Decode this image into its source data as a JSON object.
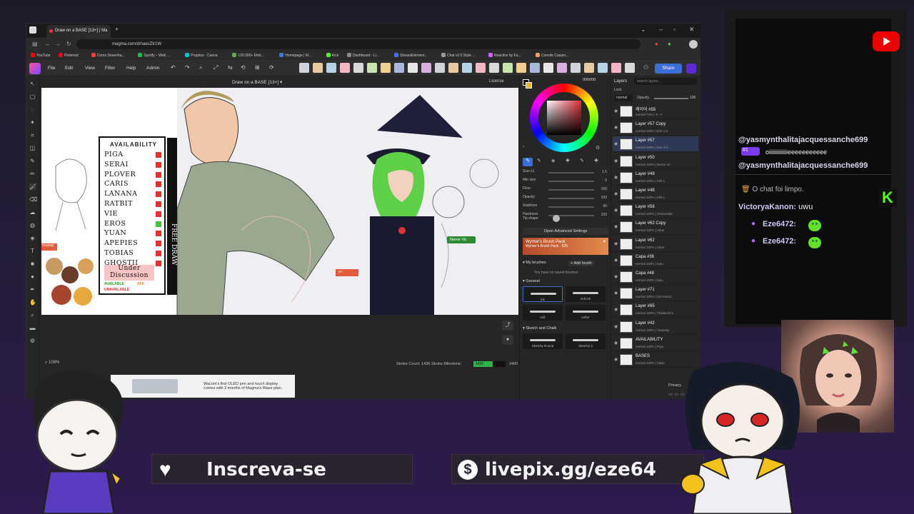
{
  "browser": {
    "tab_title": "Draw on a BASE [13+] | Ma",
    "url": "magma.com/d/naecZtr1W",
    "bookmarks": [
      {
        "label": "YouTube",
        "color": "#ff0000"
      },
      {
        "label": "Pinterest",
        "color": "#e60023"
      },
      {
        "label": "Como Desenha...",
        "color": "#ff3b3b"
      },
      {
        "label": "Spotify – Web ...",
        "color": "#1db954"
      },
      {
        "label": "Projetos - Canva",
        "color": "#00c4cc"
      },
      {
        "label": "100.000+ Efeit...",
        "color": "#6aa84f"
      },
      {
        "label": "Homepage | M...",
        "color": "#3c78d8"
      },
      {
        "label": "Kick",
        "color": "#53fc18"
      },
      {
        "label": "Dashboard - Li...",
        "color": "#888888"
      },
      {
        "label": "StreamElement...",
        "color": "#4b6cff"
      },
      {
        "label": "Chat v2.0 Style ...",
        "color": "#999999"
      },
      {
        "label": "Reactive by Fu...",
        "color": "#cc66ff"
      },
      {
        "label": "Convite Casam...",
        "color": "#ff9966"
      }
    ]
  },
  "app": {
    "menu": [
      "File",
      "Edit",
      "View",
      "Filter",
      "Help",
      "Admin"
    ],
    "share_label": "Share",
    "canvas_title": "Draw on a BASE [13+]",
    "license_label": "License",
    "zoom": "108%",
    "stroke_count_label": "Stroke Count: 1436",
    "stroke_milestone_label": "Stroke Milestone:",
    "stroke_value": "1436",
    "stroke_target": "2400",
    "stroke_progress": 0.6,
    "ad_text": "Wacom's first OLED pen and touch display comes with 3 months of Magma's Blaze plan.",
    "neme_tag": "Neme Vic",
    "user_tag": "ᵀᴴ'ᵀ"
  },
  "availability": {
    "title": "AVAILABILITY",
    "names": [
      {
        "name": "PIGA",
        "status": "#e03232"
      },
      {
        "name": "SERAI",
        "status": "#e03232"
      },
      {
        "name": "PLOVER",
        "status": "#e03232"
      },
      {
        "name": "CARIS",
        "status": "#e03232"
      },
      {
        "name": "LANANA",
        "status": "#e03232"
      },
      {
        "name": "RATBIT",
        "status": "#e03232"
      },
      {
        "name": "VIE",
        "status": "#e03232"
      },
      {
        "name": "EROS",
        "status": "#3cc43c"
      },
      {
        "name": "YUAN",
        "status": "#e03232"
      },
      {
        "name": "APEPIES",
        "status": "#e03232"
      },
      {
        "name": "TOBIAS",
        "status": "#e03232"
      },
      {
        "name": "GHOSTII",
        "status": "#e03232"
      }
    ],
    "under_discussion": "Under Discussion",
    "legend_available": "AVAILABLE",
    "legend_afk": "AFK",
    "legend_unavailable": "UNAVAILABLE",
    "free_draw": "FREE DRAW",
    "munay": "munay"
  },
  "brush": {
    "hex": "000000",
    "sliders": [
      {
        "label": "Size x1",
        "value": "1.5"
      },
      {
        "label": "Min size",
        "value": "0"
      },
      {
        "label": "Flow",
        "value": "100"
      },
      {
        "label": "Opacity",
        "value": "100"
      },
      {
        "label": "Stabilizer",
        "value": "66"
      },
      {
        "label": "Hardness",
        "value": "100"
      }
    ],
    "tip_shape": "Tip shape",
    "open_advanced": "Open Advanced Settings",
    "pack_title": "Wynter's Brush Pack",
    "pack_sub": "Wynter's Brush Pack · 525",
    "my_brushes": "My brushes",
    "add_brush": "Add brush",
    "no_brushes": "You have no saved brushes",
    "general": "General",
    "brushes_general": [
      "ink",
      "soft ink",
      "soft",
      "softer"
    ],
    "sketch": "Sketch and Chalk",
    "brushes_sketch": [
      "Sketchy Round",
      "Sketchy 2"
    ]
  },
  "layers": {
    "header": "Layers",
    "search_placeholder": "search layers...",
    "lock": "Lock",
    "blend": "normal",
    "opacity_label": "Opacity",
    "opacity": "100",
    "items": [
      {
        "name": "레이어 #55",
        "meta": "normal 74% | ㅎ-ㅋ",
        "selected": false
      },
      {
        "name": "Layer #57 Copy",
        "meta": "normal 100% | Eze 2.0",
        "selected": false
      },
      {
        "name": "Layer #57",
        "meta": "normal 100% | Eze 2.0",
        "selected": true
      },
      {
        "name": "Layer #50",
        "meta": "normal 100% | Neme Vic",
        "selected": false
      },
      {
        "name": "Layer #49",
        "meta": "normal 100% | AIR-L",
        "selected": false
      },
      {
        "name": "Layer #48",
        "meta": "normal 100% | AIR-L",
        "selected": false
      },
      {
        "name": "Layer #58",
        "meta": "normal 100% | Jessanalia",
        "selected": false
      },
      {
        "name": "Layer #62 Copy",
        "meta": "normal 100% | ndoe",
        "selected": false
      },
      {
        "name": "Layer #62",
        "meta": "normal 100% | ndoe",
        "selected": false
      },
      {
        "name": "Capa #36",
        "meta": "normal 100% | karu",
        "selected": false
      },
      {
        "name": "Capa #48",
        "meta": "normal 100% | karu",
        "selected": false
      },
      {
        "name": "Layer #71",
        "meta": "normal 100% | hot-mess1",
        "selected": false
      },
      {
        "name": "Layer #65",
        "meta": "normal 100% | ThaliaChris",
        "selected": false
      },
      {
        "name": "Layer #42",
        "meta": "normal 100% | Yuanasy",
        "selected": false
      },
      {
        "name": "AVAILABILITY",
        "meta": "normal 100% | Pigu",
        "selected": false
      },
      {
        "name": "BASES",
        "meta": "normal 100% | Iskan",
        "selected": false
      }
    ],
    "privacy": "Privacy"
  },
  "chat": {
    "messages": [
      {
        "user": "@yasmynthalitajacquessanche699",
        "text": ""
      },
      {
        "user": "",
        "badge": "#1",
        "text": "oiiiiiiiiiiiiieeeeeeeeeee"
      },
      {
        "user": "@yasmynthalitajacquessanche699",
        "text": ""
      }
    ],
    "cleared": "O chat foi limpo.",
    "victorya_user": "VictoryaKanon:",
    "victorya_text": "uwu",
    "eze_user_1": "Eze6472:",
    "eze_user_2": "Eze6472:"
  },
  "overlay": {
    "subscribe": "Inscreva-se",
    "livepix": "livepix.gg/eze64"
  }
}
